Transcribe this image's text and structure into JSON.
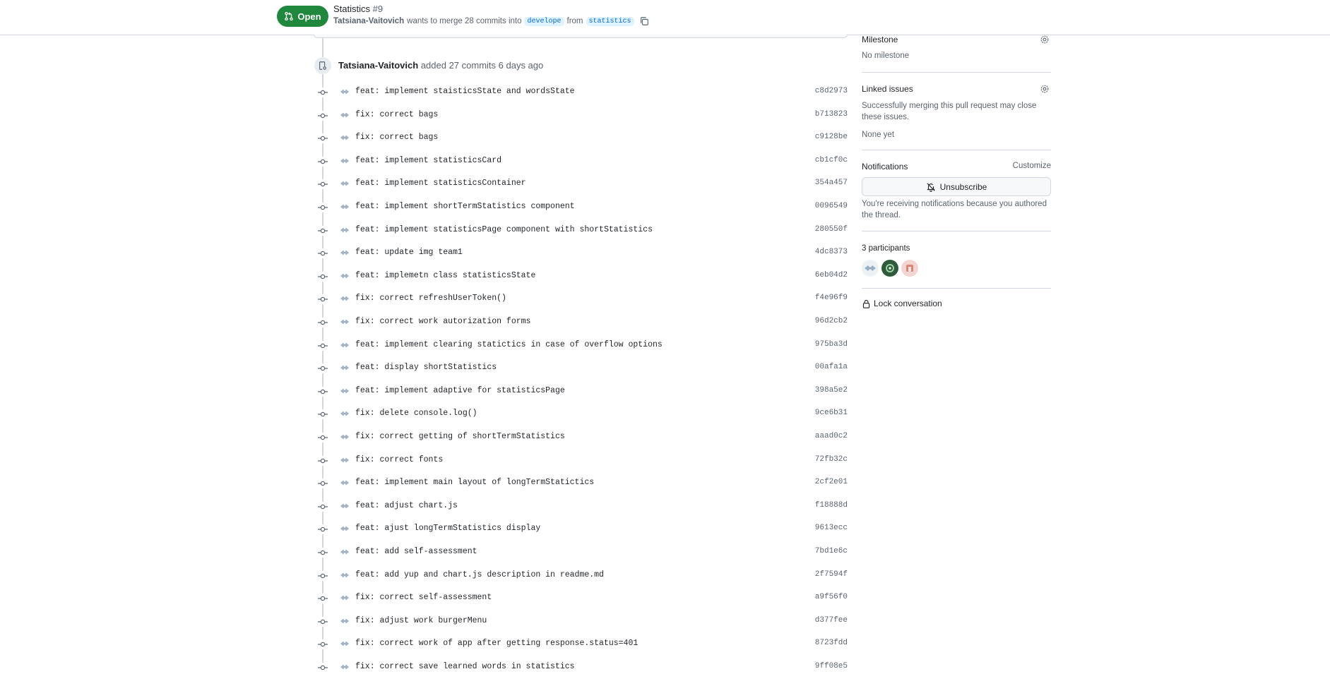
{
  "header": {
    "state": "Open",
    "title": "Statistics",
    "number": "#9",
    "author": "Tatsiana-Vaitovich",
    "merge_text": "wants to merge 28 commits into",
    "base_branch": "develope",
    "from_text": "from",
    "head_branch": "statistics"
  },
  "event": {
    "actor": "Tatsiana-Vaitovich",
    "text": "added 27 commits 6 days ago"
  },
  "commits": [
    {
      "msg": "feat: implement staisticsState and wordsState",
      "sha": "c8d2973"
    },
    {
      "msg": "fix: correct bags",
      "sha": "b713823"
    },
    {
      "msg": "fix: correct bags",
      "sha": "c9128be"
    },
    {
      "msg": "feat: implement statisticsCard",
      "sha": "cb1cf0c"
    },
    {
      "msg": "feat: implement statisticsContainer",
      "sha": "354a457"
    },
    {
      "msg": "feat: implement shortTermStatistics component",
      "sha": "0096549"
    },
    {
      "msg": "feat: implement statisticsPage component with shortStatistics",
      "sha": "280550f"
    },
    {
      "msg": "feat: update img team1",
      "sha": "4dc8373"
    },
    {
      "msg": "feat: implemetn class statisticsState",
      "sha": "6eb04d2"
    },
    {
      "msg": "fix: correct refreshUserToken()",
      "sha": "f4e96f9"
    },
    {
      "msg": "fix: correct work autorization forms",
      "sha": "96d2cb2"
    },
    {
      "msg": "feat: implement clearing statictics in case of overflow options",
      "sha": "975ba3d"
    },
    {
      "msg": "feat: display shortStatistics",
      "sha": "00afa1a"
    },
    {
      "msg": "feat: implement adaptive for statisticsPage",
      "sha": "398a5e2"
    },
    {
      "msg": "fix: delete console.log()",
      "sha": "9ce6b31"
    },
    {
      "msg": "fix: correct getting of shortTermStatistics",
      "sha": "aaad0c2"
    },
    {
      "msg": "fix: correct fonts",
      "sha": "72fb32c"
    },
    {
      "msg": "feat: implement main layout of longTermStatictics",
      "sha": "2cf2e01"
    },
    {
      "msg": "feat: adjust chart.js",
      "sha": "f18888d"
    },
    {
      "msg": "feat: ajust longTermStatistics display",
      "sha": "9613ecc"
    },
    {
      "msg": "feat: add self-assessment",
      "sha": "7bd1e6c"
    },
    {
      "msg": "feat: add yup and chart.js description in readme.md",
      "sha": "2f7594f"
    },
    {
      "msg": "fix: correct self-assessment",
      "sha": "a9f56f0"
    },
    {
      "msg": "fix: adjust work burgerMenu",
      "sha": "d377fee"
    },
    {
      "msg": "fix: correct work of app after getting response.status=401",
      "sha": "8723fdd"
    },
    {
      "msg": "fix: correct save learned words in statistics",
      "sha": "9ff08e5"
    }
  ],
  "sidebar": {
    "milestone": {
      "heading": "Milestone",
      "value": "No milestone"
    },
    "linked_issues": {
      "heading": "Linked issues",
      "description": "Successfully merging this pull request may close these issues.",
      "value": "None yet"
    },
    "notifications": {
      "heading": "Notifications",
      "customize": "Customize",
      "button": "Unsubscribe",
      "description": "You're receiving notifications because you authored the thread."
    },
    "participants": {
      "heading": "3 participants"
    },
    "lock": "Lock conversation"
  },
  "colors": {
    "open_green": "#1f883d",
    "link_blue": "#0969da",
    "muted": "#59636e",
    "border": "#d0d7de"
  }
}
